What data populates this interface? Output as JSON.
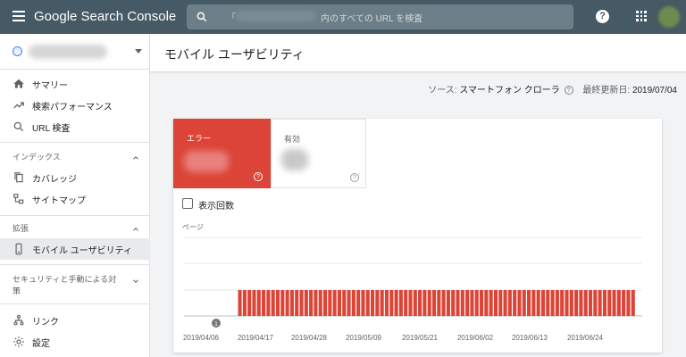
{
  "app": {
    "title": "Google Search Console",
    "search_prefix": "「",
    "search_placeholder": "内のすべての URL を検査",
    "help_label": "?"
  },
  "sidebar": {
    "items_top": [
      {
        "icon": "home-icon",
        "label": "サマリー"
      },
      {
        "icon": "trending-up-icon",
        "label": "検索パフォーマンス"
      },
      {
        "icon": "search-icon",
        "label": "URL 検査"
      }
    ],
    "section_index": "インデックス",
    "items_index": [
      {
        "icon": "file-copy-icon",
        "label": "カバレッジ"
      },
      {
        "icon": "sitemap-icon",
        "label": "サイトマップ"
      }
    ],
    "section_enhancements": "拡張",
    "items_enh": [
      {
        "icon": "smartphone-icon",
        "label": "モバイル ユーザビリティ"
      }
    ],
    "section_security": "セキュリティと手動による対策",
    "items_bottom": [
      {
        "icon": "links-icon",
        "label": "リンク"
      },
      {
        "icon": "settings-icon",
        "label": "設定"
      }
    ]
  },
  "main": {
    "title": "モバイル ユーザビリティ",
    "source_label": "ソース:",
    "source_value": "スマートフォン クローラ",
    "updated_label": "最終更新日:",
    "updated_value": "2019/07/04"
  },
  "stats": {
    "error_label": "エラー",
    "valid_label": "有効"
  },
  "checkbox_label": "表示回数",
  "colors": {
    "topbar": "#455a64",
    "error": "#db4437",
    "bar": "#db4437"
  },
  "chart_data": {
    "type": "bar",
    "ylabel": "ページ",
    "x_start": "2019/04/06",
    "x_end": "2019/07/03",
    "xticks": [
      "2019/04/06",
      "2019/04/17",
      "2019/04/28",
      "2019/05/09",
      "2019/05/21",
      "2019/06/02",
      "2019/06/13",
      "2019/06/24"
    ],
    "series": [
      {
        "values": [
          0,
          0,
          0,
          0,
          0,
          1,
          1,
          1,
          1,
          1,
          1,
          1,
          1,
          1,
          1,
          1,
          1,
          1,
          1,
          1,
          1,
          1,
          1,
          1,
          1,
          1,
          1,
          1,
          1,
          1,
          1,
          1,
          1,
          1,
          1,
          1,
          1,
          1,
          1,
          1,
          1,
          1,
          1,
          1,
          1,
          1,
          1,
          1,
          1,
          1,
          1,
          1,
          1,
          1,
          1,
          1,
          1,
          1,
          1,
          1,
          1,
          1,
          1,
          1,
          1,
          1,
          1,
          1,
          1,
          1,
          1,
          1,
          1,
          1,
          1,
          1,
          1,
          1,
          1,
          1,
          1,
          1,
          1,
          1,
          1,
          1,
          1,
          1,
          1
        ]
      }
    ],
    "grid": true,
    "annotation": "1"
  }
}
